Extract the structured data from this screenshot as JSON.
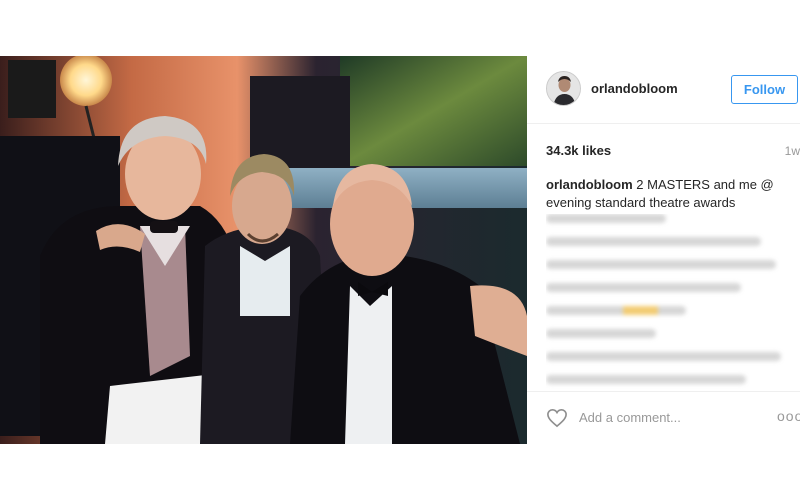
{
  "post": {
    "username": "orlandobloom",
    "follow_label": "Follow",
    "likes": "34.3k likes",
    "time": "1w",
    "caption_user": "orlandobloom",
    "caption_text": " 2 MASTERS and me @ evening standard theatre awards",
    "comment_placeholder": "Add a comment...",
    "more_label": "ooo"
  },
  "icons": {
    "heart": "heart-outline-icon",
    "more": "more-options-icon"
  },
  "colors": {
    "accent": "#3897f0",
    "muted": "#999999"
  }
}
